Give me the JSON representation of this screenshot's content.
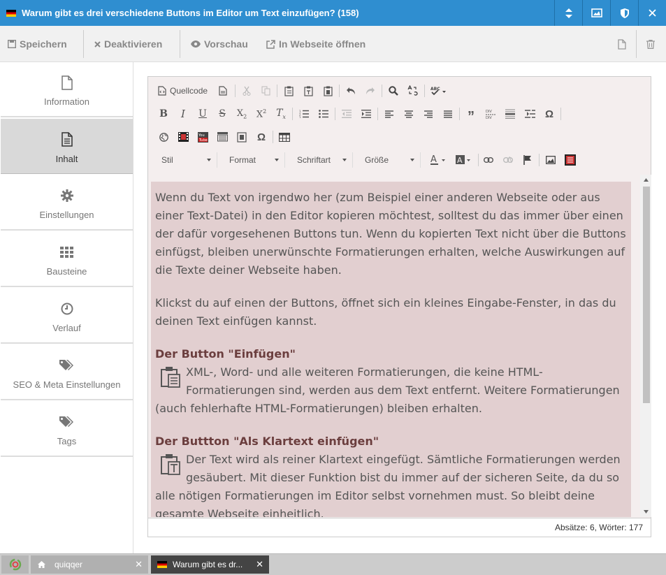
{
  "window": {
    "title": "Warum gibt es drei verschiedene Buttons im Editor um Text einzufügen? (158)"
  },
  "actions": {
    "save": "Speichern",
    "deactivate": "Deaktivieren",
    "preview": "Vorschau",
    "open_web": "In Webseite öffnen"
  },
  "sidebar": {
    "items": [
      {
        "label": "Information",
        "icon": "file-icon"
      },
      {
        "label": "Inhalt",
        "icon": "document-text-icon"
      },
      {
        "label": "Einstellungen",
        "icon": "gear-icon"
      },
      {
        "label": "Bausteine",
        "icon": "grid-icon"
      },
      {
        "label": "Verlauf",
        "icon": "clock-icon"
      },
      {
        "label": "SEO & Meta Einstellungen",
        "icon": "tags-icon"
      },
      {
        "label": "Tags",
        "icon": "tags-icon"
      }
    ]
  },
  "editor": {
    "source_label": "Quellcode",
    "combos": {
      "style": "Stil",
      "format": "Format",
      "font": "Schriftart",
      "size": "Größe"
    },
    "content": {
      "p1": "Wenn du Text von irgendwo her (zum Beispiel einer anderen Webseite oder aus einer Text-Datei) in den Editor kopieren möchtest, solltest du das immer über einen der dafür vorgesehenen Buttons tun. Wenn du kopierten Text nicht über die Buttons einfügst, bleiben unerwünschte Formatierungen erhalten, welche Auswirkungen auf die Texte deiner Webseite haben.",
      "p2": "Klickst du auf einen der Buttons, öffnet sich ein kleines Eingabe-Fenster, in das du deinen Text einfügen kannst.",
      "h1": "Der Button \"Einfügen\"",
      "p3": "XML-, Word- und alle weiteren Formatierungen, die keine HTML-Formatierungen sind, werden aus dem Text entfernt. Weitere Formatierungen (auch fehlerhafte HTML-Formatierungen) bleiben erhalten.",
      "h2": "Der Buttton \"Als Klartext einfügen\"",
      "p4": "Der Text wird als reiner Klartext eingefügt. Sämtliche Formatierungen werden gesäubert. Mit dieser Funktion bist du immer auf der sicheren Seite, da du so alle nötigen Formatierungen im Editor selbst vornehmen must. So bleibt deine gesamte Webseite einheitlich."
    },
    "status": "Absätze: 6, Wörter: 177"
  },
  "taskbar": {
    "tabs": [
      {
        "label": "quiqqer"
      },
      {
        "label": "Warum gibt es dr..."
      }
    ]
  },
  "colors": {
    "titlebar": "#2f8ed0",
    "content_bg": "#e2cfd0",
    "heading": "#6b3e3e",
    "active_task": "#444444"
  }
}
